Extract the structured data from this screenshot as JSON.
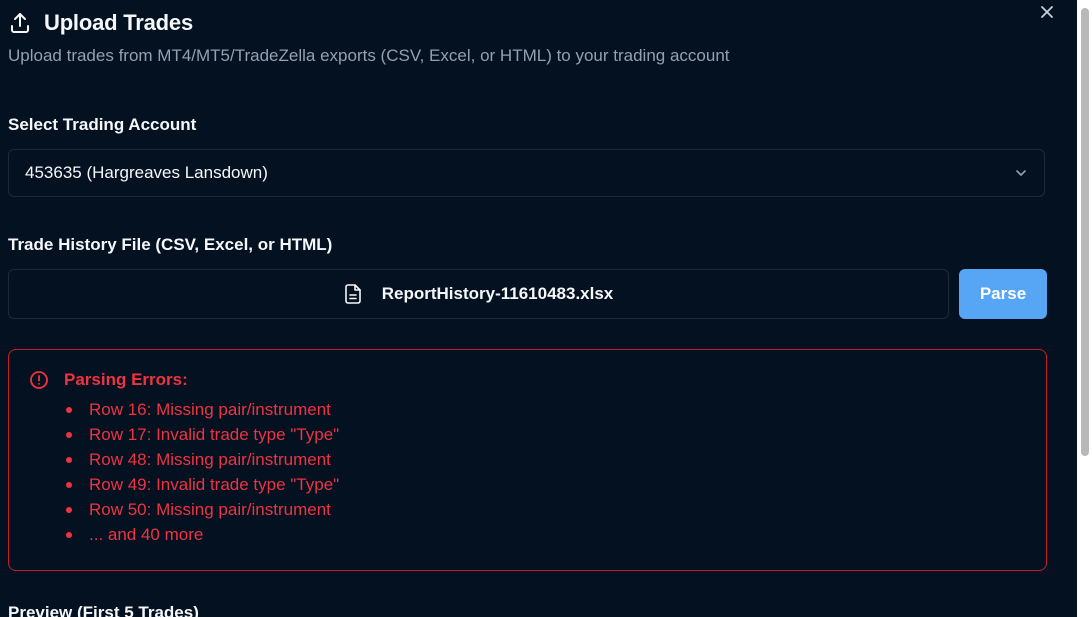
{
  "dialog": {
    "title": "Upload Trades",
    "subtitle": "Upload trades from MT4/MT5/TradeZella exports (CSV, Excel, or HTML) to your trading account",
    "icons": {
      "title": "upload-icon",
      "close": "close-icon",
      "select": "chevron-down-icon",
      "file": "file-icon",
      "error": "alert-circle-icon"
    }
  },
  "account": {
    "label": "Select Trading Account",
    "selected": "453635 (Hargreaves Lansdown)"
  },
  "file": {
    "label": "Trade History File (CSV, Excel, or HTML)",
    "name": "ReportHistory-11610483.xlsx",
    "parse_label": "Parse"
  },
  "errors": {
    "title": "Parsing Errors:",
    "items": [
      "Row 16: Missing pair/instrument",
      "Row 17: Invalid trade type \"Type\"",
      "Row 48: Missing pair/instrument",
      "Row 49: Invalid trade type \"Type\"",
      "Row 50: Missing pair/instrument",
      "... and 40 more"
    ]
  },
  "preview": {
    "title": "Preview (First 5 Trades)"
  },
  "colors": {
    "background": "#031121",
    "accent": "#57a6f5",
    "error": "#ef3340",
    "muted_text": "#93a0b0"
  }
}
